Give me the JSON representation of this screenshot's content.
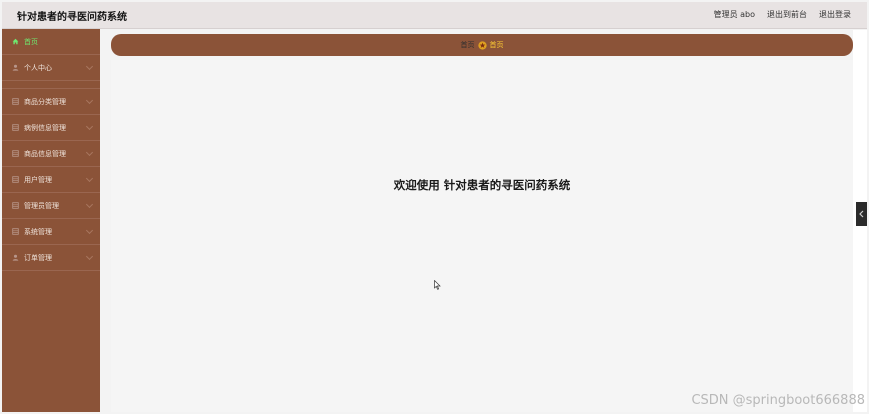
{
  "header": {
    "title": "针对患者的寻医问药系统",
    "admin_label": "管理员 abo",
    "to_front_label": "退出到前台",
    "logout_label": "退出登录"
  },
  "sidebar": {
    "items": [
      {
        "label": "首页",
        "icon": "home-icon"
      },
      {
        "label": "个人中心",
        "icon": "user-icon"
      },
      {
        "label": "商品分类管理",
        "icon": "grid-icon"
      },
      {
        "label": "病例信息管理",
        "icon": "grid-icon"
      },
      {
        "label": "商品信息管理",
        "icon": "grid-icon"
      },
      {
        "label": "用户管理",
        "icon": "grid-icon"
      },
      {
        "label": "管理员管理",
        "icon": "grid-icon"
      },
      {
        "label": "系统管理",
        "icon": "grid-icon"
      },
      {
        "label": "订单管理",
        "icon": "user-icon"
      }
    ]
  },
  "breadcrumb": {
    "home": "首页",
    "current": "首页"
  },
  "main": {
    "welcome": "欢迎使用 针对患者的寻医问药系统"
  },
  "watermark": "CSDN @springboot666888",
  "colors": {
    "sidebar_bg": "#8b5338",
    "header_bg": "#e8e3e3",
    "active_menu": "#6fe86f",
    "breadcrumb_current": "#ffcc33"
  }
}
